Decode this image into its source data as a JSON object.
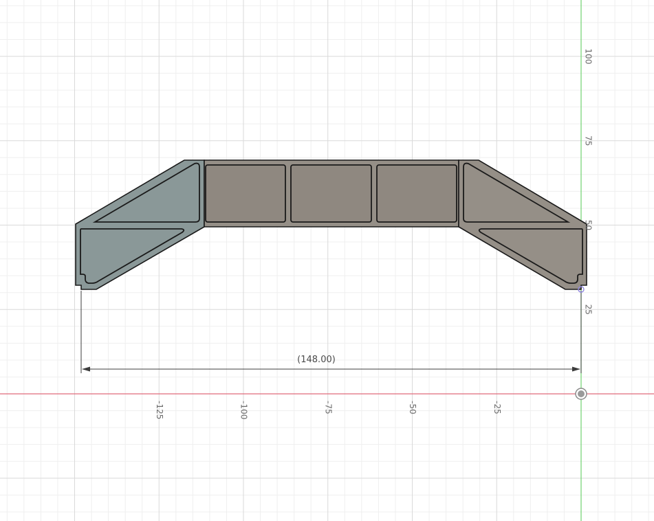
{
  "sketch": {
    "colors": {
      "background": "#ffffff",
      "grid_minor": "#efefef",
      "grid_major": "#d9d9d9",
      "x_axis": "#e06a7a",
      "y_axis": "#6ed36e",
      "profile_fill_left": "#8a9898",
      "profile_fill_right": "#958f87",
      "profile_stroke": "#1a1a1a",
      "cell_fill": "#8f8880",
      "dimension_line": "#3c3c3c"
    },
    "x_ticks": [
      {
        "value": -125,
        "label": "-125"
      },
      {
        "value": -100,
        "label": "-100"
      },
      {
        "value": -75,
        "label": "-75"
      },
      {
        "value": -50,
        "label": "-50"
      },
      {
        "value": -25,
        "label": "-25"
      }
    ],
    "y_ticks": [
      {
        "value": 100,
        "label": "100"
      },
      {
        "value": 75,
        "label": "75"
      },
      {
        "value": 50,
        "label": "50"
      },
      {
        "value": 25,
        "label": "25"
      }
    ],
    "dimension": {
      "label": "(148.00)",
      "value": 148.0
    },
    "origin_icon": "origin-point-icon",
    "constraint_icon": "coincident-point-icon"
  }
}
